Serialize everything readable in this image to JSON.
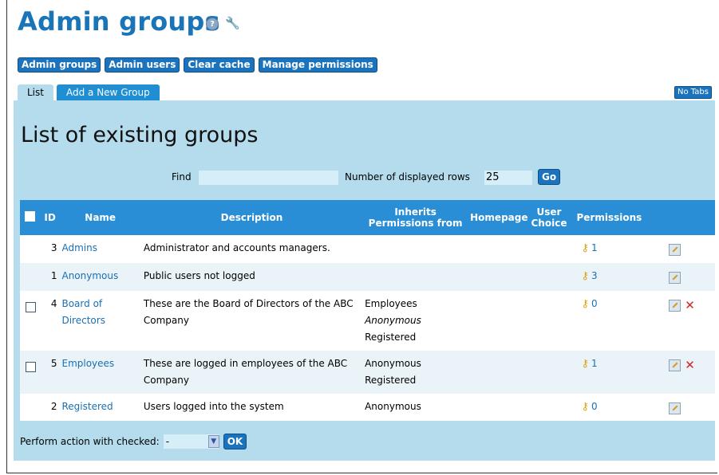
{
  "header": {
    "title": "Admin groups"
  },
  "nav": {
    "buttons": [
      "Admin groups",
      "Admin users",
      "Clear cache",
      "Manage permissions"
    ]
  },
  "tabs": {
    "items": [
      "List",
      "Add a New Group"
    ],
    "notabs": "No Tabs"
  },
  "panel": {
    "title": "List of existing groups",
    "find_label": "Find",
    "find_value": "",
    "rows_label": "Number of displayed rows",
    "rows_value": "25",
    "go_label": "Go"
  },
  "table": {
    "columns": [
      "ID",
      "Name",
      "Description",
      "Inherits Permissions from",
      "Homepage",
      "User Choice",
      "Permissions"
    ],
    "rows": [
      {
        "id": "3",
        "name": "Admins",
        "description": "Administrator and accounts managers.",
        "inherits": [],
        "permissions": "1",
        "checkbox": false,
        "deletable": false
      },
      {
        "id": "1",
        "name": "Anonymous",
        "description": "Public users not logged",
        "inherits": [],
        "permissions": "3",
        "checkbox": false,
        "deletable": false
      },
      {
        "id": "4",
        "name": "Board of Directors",
        "description": "These are the Board of Directors of the ABC Company",
        "inherits": [
          "Employees",
          "Anonymous",
          "Registered"
        ],
        "permissions": "0",
        "checkbox": true,
        "deletable": true
      },
      {
        "id": "5",
        "name": "Employees",
        "description": "These are logged in employees of the ABC Company",
        "inherits": [
          "Anonymous",
          "Registered"
        ],
        "permissions": "1",
        "checkbox": true,
        "deletable": true
      },
      {
        "id": "2",
        "name": "Registered",
        "description": "Users logged into the system",
        "inherits": [
          "Anonymous"
        ],
        "permissions": "0",
        "checkbox": false,
        "deletable": false
      }
    ]
  },
  "footer": {
    "action_label": "Perform action with checked:",
    "action_value": "-",
    "ok_label": "OK"
  },
  "colors": {
    "accent": "#1b73bd",
    "panel": "#b5dced",
    "header": "#2a8ed6",
    "title": "#1a75b8"
  }
}
